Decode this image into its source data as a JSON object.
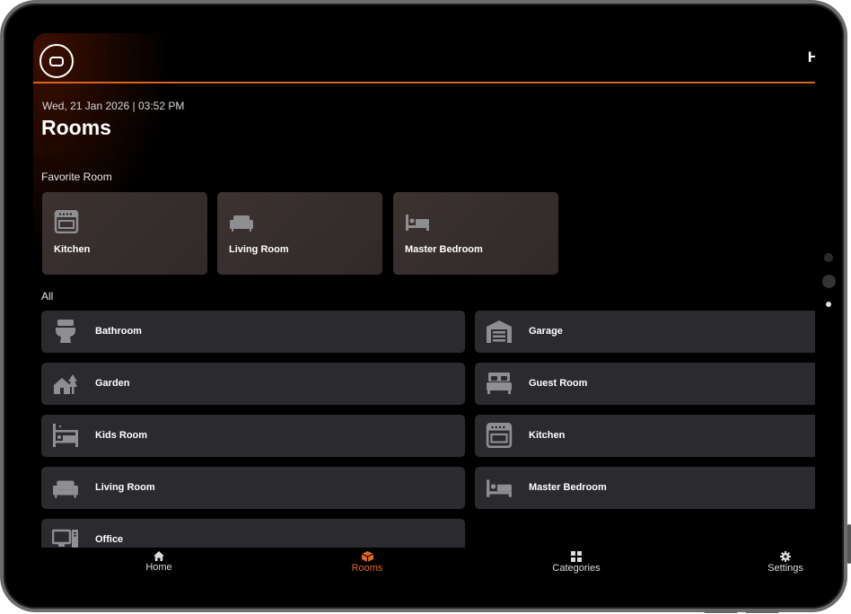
{
  "header": {
    "right_text": "H"
  },
  "datetime": "Wed, 21 Jan 2026 | 03:52 PM",
  "title": "Rooms",
  "favorite_label": "Favorite Room",
  "all_label": "All",
  "favorites": [
    {
      "name": "Kitchen",
      "icon": "oven-icon"
    },
    {
      "name": "Living Room",
      "icon": "sofa-icon"
    },
    {
      "name": "Master Bedroom",
      "icon": "bed-icon"
    }
  ],
  "rooms": [
    {
      "name": "Bathroom",
      "icon": "toilet-icon"
    },
    {
      "name": "Garage",
      "icon": "garage-icon"
    },
    {
      "name": "Garden",
      "icon": "garden-house-icon"
    },
    {
      "name": "Guest Room",
      "icon": "double-bed-icon"
    },
    {
      "name": "Kids Room",
      "icon": "bunk-bed-icon"
    },
    {
      "name": "Kitchen",
      "icon": "oven-icon"
    },
    {
      "name": "Living Room",
      "icon": "sofa-icon"
    },
    {
      "name": "Master Bedroom",
      "icon": "bed-icon"
    },
    {
      "name": "Office",
      "icon": "computer-icon"
    }
  ],
  "nav": [
    {
      "label": "Home",
      "icon": "home-icon"
    },
    {
      "label": "Rooms",
      "icon": "box-icon",
      "active": true
    },
    {
      "label": "Categories",
      "icon": "grid-icon"
    },
    {
      "label": "Settings",
      "icon": "gear-icon"
    }
  ],
  "colors": {
    "accent": "#e06a1d",
    "card": "#2b2a2f",
    "fav_card": "#3a302e",
    "icon": "#8e8e93"
  }
}
